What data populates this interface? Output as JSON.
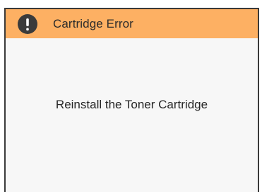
{
  "dialog": {
    "title": "Cartridge Error",
    "icon": "alert-icon",
    "message": "Reinstall the Toner Cartridge"
  },
  "colors": {
    "title_bar": "#fdb063",
    "icon_background": "#3b3b3b",
    "body_background": "#f7f7f7",
    "border": "#3a3a3a"
  }
}
